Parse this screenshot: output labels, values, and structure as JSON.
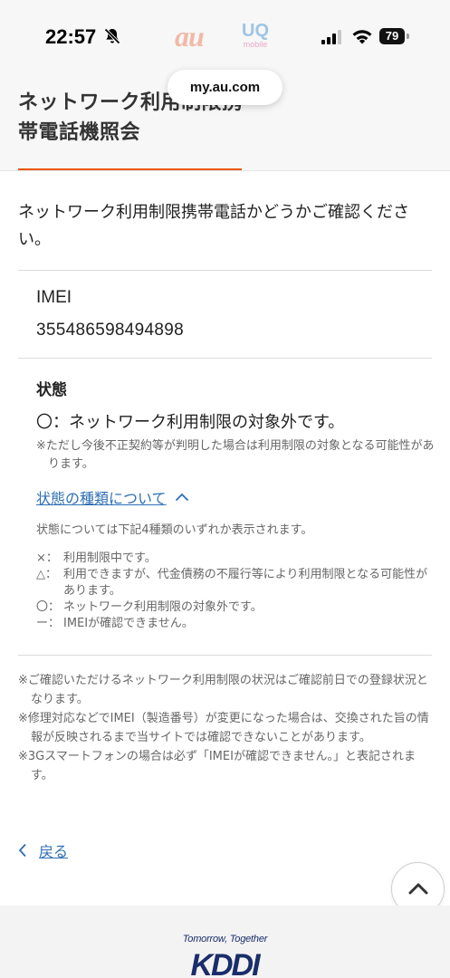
{
  "status_bar": {
    "time": "22:57",
    "battery": "79",
    "carrier_logo_au": "au",
    "carrier_logo_uq": "UQ",
    "carrier_logo_uq_sub": "mobile"
  },
  "browser": {
    "url": "my.au.com"
  },
  "header": {
    "title": "ネットワーク利用制限携帯電話機照会",
    "accent_color": "#eb5505"
  },
  "main": {
    "intro": "ネットワーク利用制限携帯電話かどうかご確認ください。",
    "imei_label": "IMEI",
    "imei_value": "355486598494898",
    "status_label": "状態",
    "status_value": "〇：ネットワーク利用制限の対象外です。",
    "status_note": "※ただし今後不正契約等が判明した場合は利用制限の対象となる可能性があります。",
    "status_types_link": "状態の種類について",
    "types_intro": "状態については下記4種類のいずれか表示されます。",
    "types": [
      {
        "symbol": "×：",
        "text": "利用制限中です。"
      },
      {
        "symbol": "△：",
        "text": "利用できますが、代金債務の不履行等により利用制限となる可能性があります。"
      },
      {
        "symbol": "〇：",
        "text": "ネットワーク利用制限の対象外です。"
      },
      {
        "symbol": "ー：",
        "text": "IMEIが確認できません。"
      }
    ],
    "footnotes": [
      "※ご確認いただけるネットワーク利用制限の状況はご確認前日での登録状況となります。",
      "※修理対応などでIMEI（製造番号）が変更になった場合は、交換された旨の情報が反映されるまで当サイトでは確認できないことがあります。",
      "※3Gスマートフォンの場合は必ず「IMEIが確認できません。」と表記されます。"
    ],
    "back_label": "戻る",
    "link_color": "#2d6fb4"
  },
  "footer": {
    "tagline": "Tomorrow, Together",
    "logo": "KDDI"
  }
}
